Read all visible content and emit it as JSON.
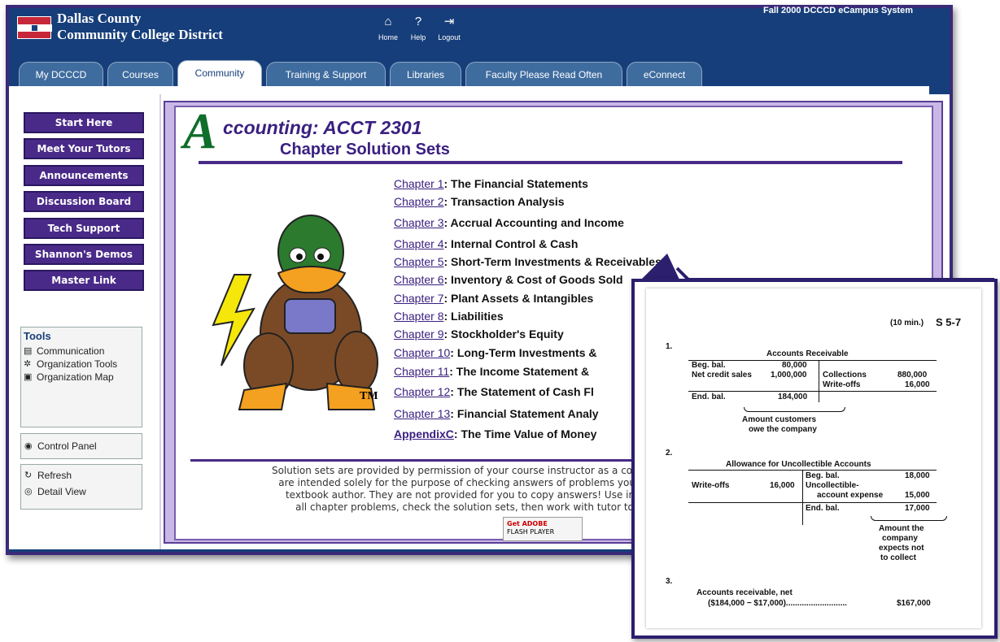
{
  "header": {
    "org_line1": "Dallas County",
    "org_line2": "Community College District",
    "system_name": "Fall 2000 DCCCD eCampus System",
    "nav": [
      {
        "label": "Home",
        "icon": "home-icon"
      },
      {
        "label": "Help",
        "icon": "help-icon"
      },
      {
        "label": "Logout",
        "icon": "logout-icon"
      }
    ]
  },
  "tabs": [
    {
      "label": "My DCCCD"
    },
    {
      "label": "Courses"
    },
    {
      "label": "Community",
      "active": true
    },
    {
      "label": "Training & Support"
    },
    {
      "label": "Libraries"
    },
    {
      "label": "Faculty Please Read Often"
    },
    {
      "label": "eConnect"
    }
  ],
  "sidebar": {
    "buttons": [
      {
        "label": "Start Here"
      },
      {
        "label": "Meet Your Tutors"
      },
      {
        "label": "Announcements"
      },
      {
        "label": "Discussion Board"
      },
      {
        "label": "Tech Support"
      },
      {
        "label": "Shannon's Demos"
      },
      {
        "label": "Master Link"
      }
    ],
    "tools_title": "Tools",
    "tools": [
      {
        "label": "Communication",
        "icon": "communication-icon"
      },
      {
        "label": "Organization Tools",
        "icon": "organization-tools-icon"
      },
      {
        "label": "Organization Map",
        "icon": "organization-map-icon"
      }
    ],
    "control_panel": "Control Panel",
    "refresh": "Refresh",
    "detail_view": "Detail View"
  },
  "page": {
    "logo_letter": "A",
    "title": "ccounting: ACCT 2301",
    "subtitle": "Chapter Solution Sets",
    "trademark": "TM",
    "chapters": [
      {
        "link": "Chapter 1",
        "title": ": The Financial Statements"
      },
      {
        "link": "Chapter 2",
        "title": ": Transaction Analysis"
      },
      {
        "link": "Chapter 3",
        "title": ": Accrual Accounting and Income"
      },
      {
        "link": "Chapter 4",
        "title": ": Internal Control & Cash"
      },
      {
        "link": "Chapter 5",
        "title": ": Short-Term Investments & Receivables"
      },
      {
        "link": "Chapter 6",
        "title": ": Inventory & Cost of Goods Sold"
      },
      {
        "link": "Chapter 7",
        "title": ": Plant Assets & Intangibles"
      },
      {
        "link": "Chapter 8",
        "title": ": Liabilities"
      },
      {
        "link": "Chapter 9",
        "title": ": Stockholder's Equity"
      },
      {
        "link": "Chapter 10",
        "title": ": Long-Term Investments &"
      },
      {
        "link": "Chapter 11",
        "title": ": The Income Statement &"
      },
      {
        "link": "Chapter 12",
        "title": ": The Statement of Cash Fl"
      },
      {
        "link": "Chapter 13",
        "title": ": Financial Statement Analy"
      },
      {
        "link": "AppendixC",
        "title": ": The Time Value of Money"
      }
    ],
    "footer_lines": [
      "Solution sets are provided by permission of your course instructor as a courtes",
      "are intended solely for the purpose of checking answers of problems you ha",
      "textbook author. They are not provided for you to copy answers! Use inst",
      "all chapter problems, check the solution sets, then work with tutor to"
    ],
    "flash_badge": {
      "line1": "Get ADOBE",
      "line2": "FLASH PLAYER"
    }
  },
  "solution_excerpt": {
    "header_time": "(10 min.)",
    "header_id": "S 5-7",
    "n1": "1.",
    "ar_title": "Accounts Receivable",
    "ar_beg": "Beg. bal.",
    "ar_beg_amt": "80,000",
    "ar_credit": "Net credit sales",
    "ar_credit_amt": "1,000,000",
    "ar_coll": "Collections",
    "ar_coll_amt": "880,000",
    "ar_wo": "Write-offs",
    "ar_wo_amt": "16,000",
    "ar_end": "End. bal.",
    "ar_end_amt": "184,000",
    "ar_note1": "Amount customers",
    "ar_note2": "owe the company",
    "n2": "2.",
    "al_title": "Allowance for Uncollectible Accounts",
    "al_beg": "Beg. bal.",
    "al_beg_amt": "18,000",
    "al_wo": "Write-offs",
    "al_wo_amt": "16,000",
    "al_unc1": "Uncollectible-",
    "al_unc2": "account expense",
    "al_unc_amt": "15,000",
    "al_end": "End. bal.",
    "al_end_amt": "17,000",
    "al_note1": "Amount the",
    "al_note2": "company",
    "al_note3": "expects not",
    "al_note4": "to collect",
    "n3": "3.",
    "ar_net1": "Accounts receivable, net",
    "ar_net2": "($184,000 − $17,000)...........................",
    "ar_net_amt": "$167,000"
  }
}
